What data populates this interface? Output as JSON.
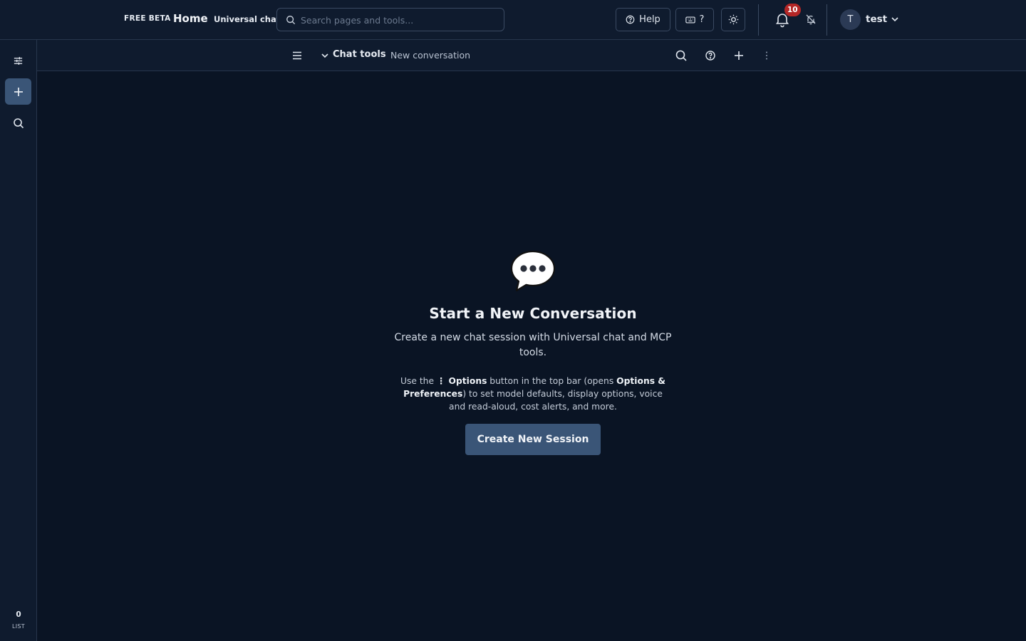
{
  "topbar": {
    "badge": "FREE BETA",
    "home": "Home",
    "app": "Universal chat",
    "search_placeholder": "Search pages and tools...",
    "help_label": "Help",
    "shortcuts_label": "?",
    "notifications_count": "10",
    "user_initial": "T",
    "user_name": "test"
  },
  "rail": {
    "count": "0",
    "list_label": "LIST"
  },
  "subbar": {
    "tools_label": "Chat tools",
    "conversation_title": "New conversation"
  },
  "empty_state": {
    "title": "Start a New Conversation",
    "lead": "Create a new chat session with Universal chat and MCP tools.",
    "hint_1": "Use the ",
    "hint_options": "⋮ Options",
    "hint_2": " button in the top bar (opens ",
    "hint_prefs": "Options & Preferences",
    "hint_3": ") to set model defaults, display options, voice and read-aloud, cost alerts, and more.",
    "button": "Create New Session"
  },
  "colors": {
    "background": "#0a1424",
    "bar": "#0f1b2e",
    "accent": "#3a5577",
    "badge": "#b32626"
  }
}
